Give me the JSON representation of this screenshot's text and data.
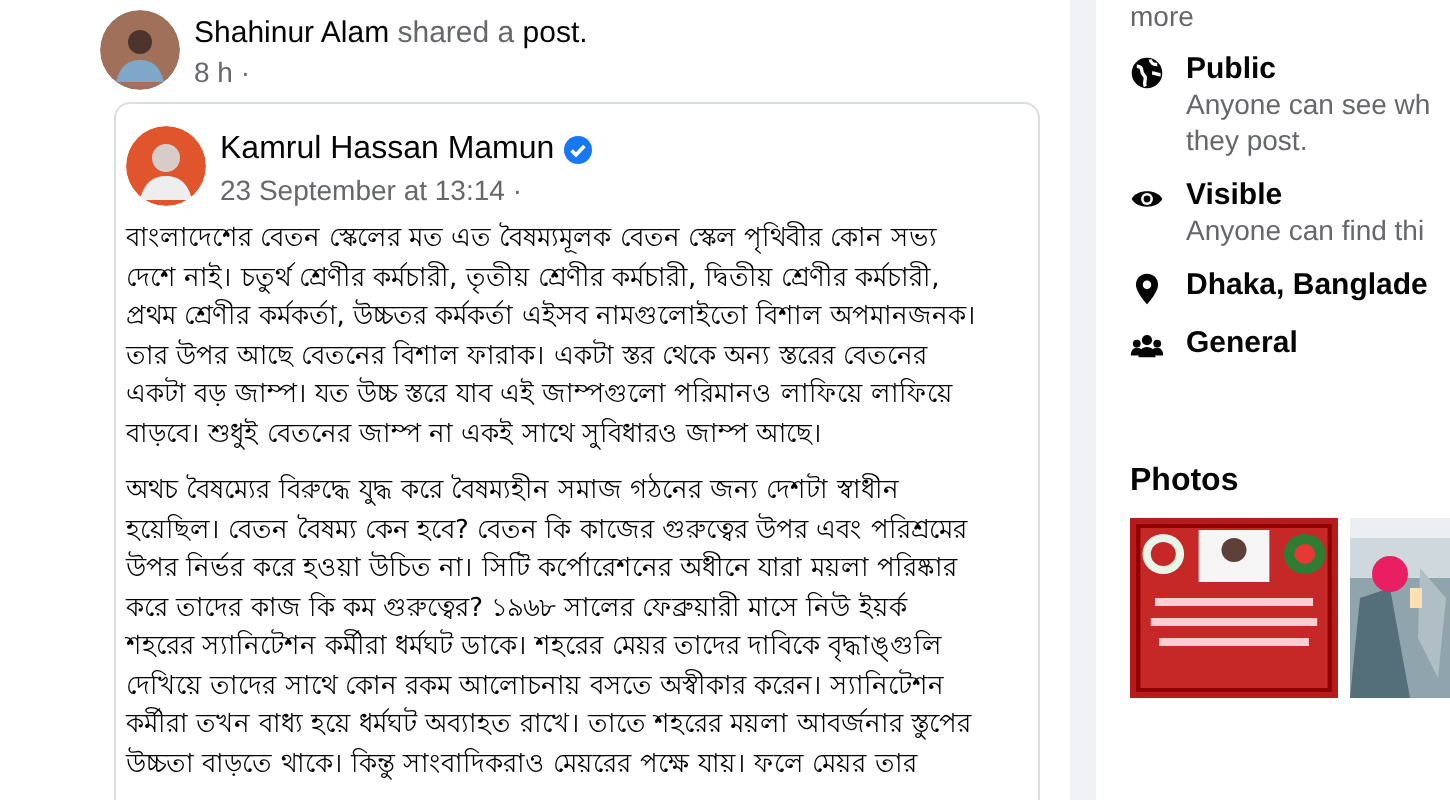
{
  "post": {
    "author": "Shahinur Alam",
    "action": "shared a",
    "object": "post.",
    "time": "8 h ·",
    "shared": {
      "author": "Kamrul Hassan Mamun",
      "verified": true,
      "time": "23 September at 13:14 ·",
      "paragraphs": [
        {
          "lines": [
            "বাংলাদেশের বেতন স্কেলের মত এত বৈষম্যমূলক বেতন স্কেল পৃথিবীর কোন সভ্য",
            "দেশে নাই। চতুর্থ শ্রেণীর কর্মচারী, তৃতীয় শ্রেণীর কর্মচারী, দ্বিতীয় শ্রেণীর কর্মচারী,",
            "প্রথম শ্রেণীর কর্মকর্তা, উচ্চতর কর্মকর্তা এইসব নামগুলোইতো বিশাল অপমানজনক।",
            "তার উপর আছে বেতনের বিশাল ফারাক। একটা স্তর থেকে অন্য স্তরের বেতনের",
            "একটা বড় জাম্প। যত উচ্চ স্তরে যাব এই জাম্পগুলো পরিমানও লাফিয়ে লাফিয়ে",
            "বাড়বে। শুধুই বেতনের জাম্প না একই সাথে সুবিধারও জাম্প আছে।"
          ]
        },
        {
          "lines": [
            "অথচ বৈষম্যের বিরুদ্ধে যুদ্ধ করে বৈষম্যহীন সমাজ গঠনের জন্য দেশটা স্বাধীন",
            "হয়েছিল। বেতন বৈষম্য কেন হবে? বেতন কি কাজের গুরুত্বের উপর এবং পরিশ্রমের",
            "উপর নির্ভর করে হওয়া উচিত না। সিটি কর্পোরেশনের অধীনে যারা ময়লা পরিষ্কার",
            "করে তাদের কাজ কি কম গুরুত্বের? ১৯৬৮ সালের ফেব্রুয়ারী মাসে নিউ ইয়র্ক",
            "শহরের  স্যানিটেশন কর্মীরা ধর্মঘট ডাকে। শহরের মেয়র তাদের দাবিকে বৃদ্ধাঙ্গুলি",
            "দেখিয়ে তাদের সাথে কোন রকম আলোচনায় বসতে অস্বীকার করেন।  স্যানিটেশন",
            "কর্মীরা তখন বাধ্য হয়ে ধর্মঘট অব্যাহত রাখে। তাতে শহরের ময়লা আবর্জনার স্তুপের",
            "উচ্চতা বাড়তে থাকে। কিন্তু সাংবাদিকরাও মেয়রের পক্ষে যায়। ফলে মেয়র তার"
          ]
        }
      ]
    }
  },
  "about": {
    "more": "more",
    "items": [
      {
        "kind": "globe",
        "title": "Public",
        "lines": [
          "Anyone can see wh",
          "they post."
        ]
      },
      {
        "kind": "eye",
        "title": "Visible",
        "lines": [
          "Anyone can find thi"
        ]
      },
      {
        "kind": "pin",
        "title": "Dhaka, Banglade"
      },
      {
        "kind": "people",
        "title": "General"
      }
    ]
  },
  "photos": {
    "title": "Photos"
  }
}
